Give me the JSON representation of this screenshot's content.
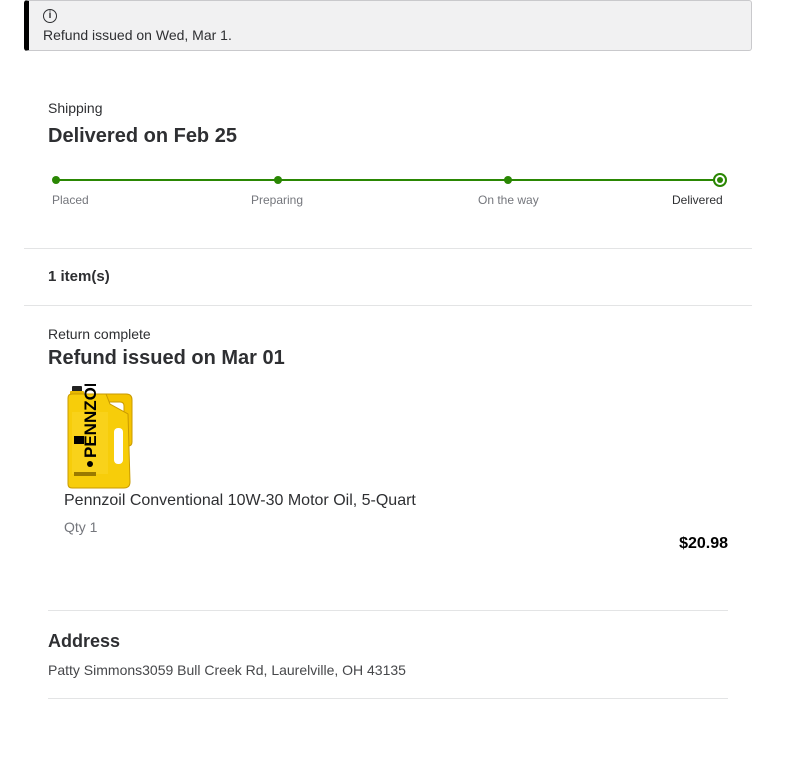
{
  "notice": {
    "icon": "info-icon",
    "text": "Refund issued on Wed, Mar 1."
  },
  "shipping": {
    "label": "Shipping",
    "title": "Delivered on Feb 25",
    "steps": [
      {
        "label": "Placed",
        "completed": true
      },
      {
        "label": "Preparing",
        "completed": true
      },
      {
        "label": "On the way",
        "completed": true
      },
      {
        "label": "Delivered",
        "completed": true,
        "current": true
      }
    ],
    "accent_color": "#2a8703"
  },
  "items": {
    "count_label": "1 item(s)"
  },
  "return": {
    "status": "Return complete",
    "title": "Refund issued on Mar 01",
    "product": {
      "image": "motor-oil-jug-image",
      "name": "Pennzoil Conventional 10W-30 Motor Oil, 5-Quart",
      "qty": "Qty 1",
      "price": "$20.98",
      "brand_text": "PENNZOIL"
    }
  },
  "address": {
    "title": "Address",
    "line": "Patty Simmons3059 Bull Creek Rd, Laurelville, OH 43135"
  }
}
